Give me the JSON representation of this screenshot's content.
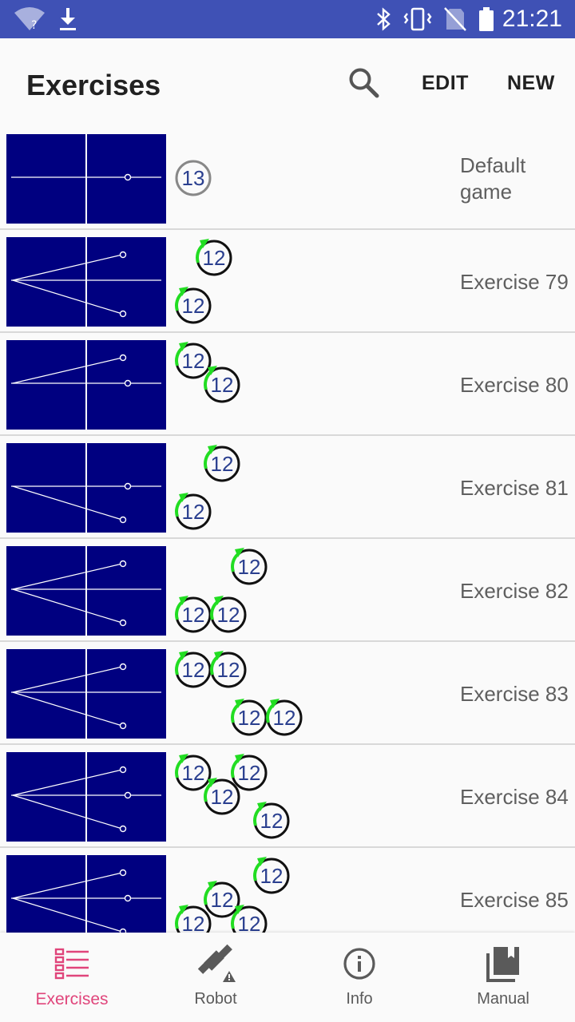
{
  "status_bar": {
    "time": "21:21",
    "icons": [
      "wifi-unknown-icon",
      "download-icon",
      "bluetooth-icon",
      "vibrate-icon",
      "no-sim-icon",
      "battery-icon"
    ]
  },
  "app_bar": {
    "title": "Exercises",
    "search_icon": "search-icon",
    "edit_label": "EDIT",
    "new_label": "NEW"
  },
  "exercises": [
    {
      "name": "Default\ngame",
      "badges": [
        "13"
      ],
      "thumb_endpoints": [
        "straight"
      ]
    },
    {
      "name": "Exercise 79",
      "badges": [
        "12",
        "12"
      ],
      "thumb_endpoints": [
        "up",
        "down"
      ]
    },
    {
      "name": "Exercise 80",
      "badges": [
        "12",
        "12"
      ],
      "thumb_endpoints": [
        "up",
        "straight"
      ]
    },
    {
      "name": "Exercise 81",
      "badges": [
        "12",
        "12"
      ],
      "thumb_endpoints": [
        "straight",
        "down"
      ]
    },
    {
      "name": "Exercise 82",
      "badges": [
        "12",
        "12",
        "12"
      ],
      "thumb_endpoints": [
        "up",
        "down"
      ]
    },
    {
      "name": "Exercise 83",
      "badges": [
        "12",
        "12",
        "12",
        "12"
      ],
      "thumb_endpoints": [
        "up",
        "down"
      ]
    },
    {
      "name": "Exercise 84",
      "badges": [
        "12",
        "12",
        "12",
        "12"
      ],
      "thumb_endpoints": [
        "up",
        "straight",
        "down"
      ]
    },
    {
      "name": "Exercise 85",
      "badges": [
        "12",
        "12",
        "12",
        "12"
      ],
      "thumb_endpoints": [
        "up",
        "straight",
        "down"
      ]
    }
  ],
  "bottom_nav": [
    {
      "label": "Exercises",
      "icon": "list-icon",
      "active": true
    },
    {
      "label": "Robot",
      "icon": "robot-warning-icon",
      "active": false
    },
    {
      "label": "Info",
      "icon": "info-icon",
      "active": false
    },
    {
      "label": "Manual",
      "icon": "books-icon",
      "active": false
    }
  ],
  "colors": {
    "status_bar": "#3f51b5",
    "thumb_bg": "#000080",
    "badge_arrow": "#22dd22",
    "badge_number": "#2a3f8f",
    "active_nav": "#e0457b"
  }
}
